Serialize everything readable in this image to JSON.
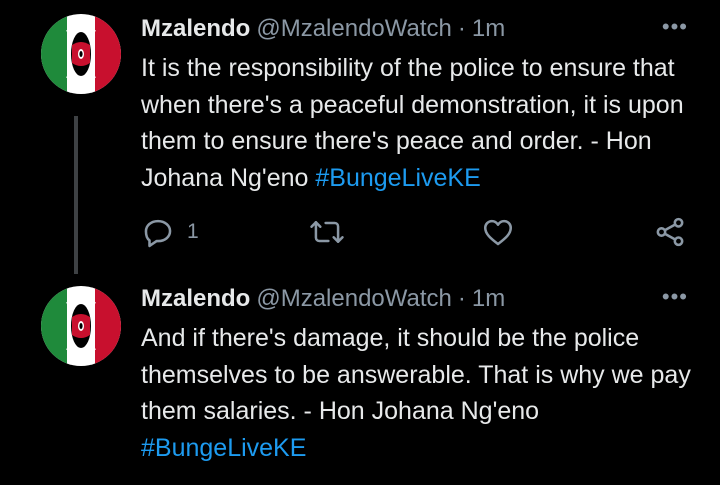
{
  "colors": {
    "background": "#000000",
    "text": "#e7e9ea",
    "muted": "#8b98a5",
    "link": "#1d9bf0",
    "thread_line": "#3e4144"
  },
  "tweets": [
    {
      "author_name": "Mzalendo",
      "handle": "@MzalendoWatch",
      "separator": "·",
      "time": "1m",
      "more_icon": "more-horizontal-icon",
      "text": "It is the responsibility of the police to ensure that when there's a peaceful demonstration, it is upon them to ensure there's peace and order. - Hon Johana Ng'eno ",
      "hashtag": "#BungeLiveKE",
      "actions": {
        "reply_icon": "reply-icon",
        "reply_count": "1",
        "retweet_icon": "retweet-icon",
        "like_icon": "heart-icon",
        "share_icon": "share-icon"
      }
    },
    {
      "author_name": "Mzalendo",
      "handle": "@MzalendoWatch",
      "separator": "·",
      "time": "1m",
      "more_icon": "more-horizontal-icon",
      "text": "And if there's damage, it should be the police themselves to be answerable. That is why we pay them salaries. - Hon Johana Ng'eno ",
      "hashtag": "#BungeLiveKE"
    }
  ]
}
